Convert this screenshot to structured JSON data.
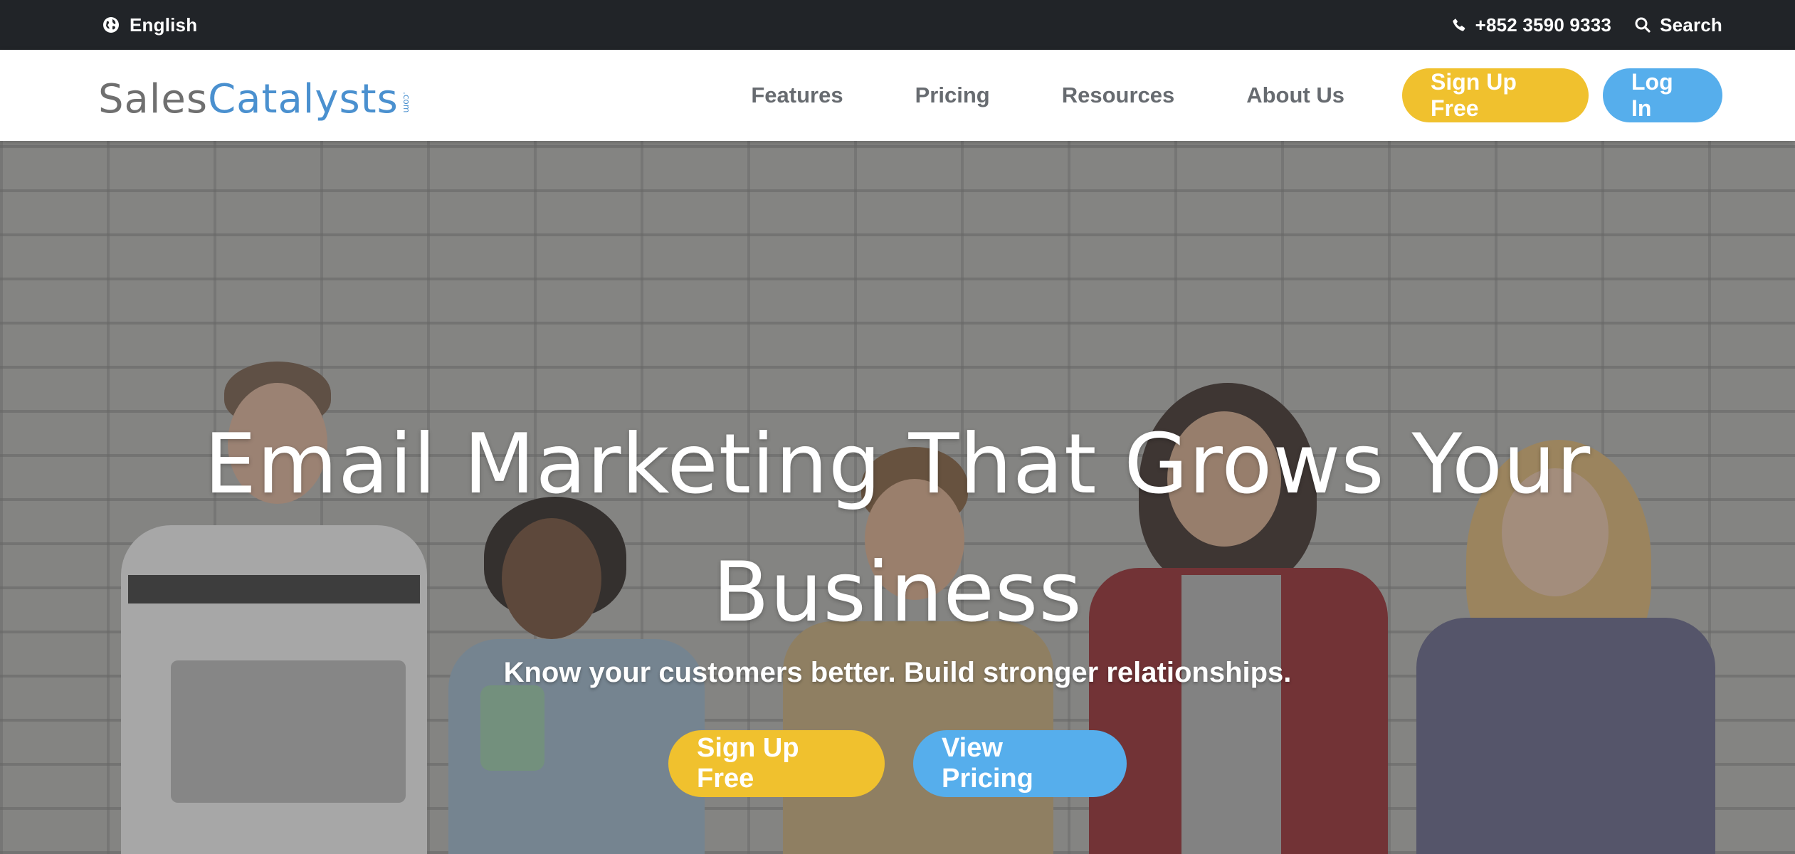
{
  "topbar": {
    "language": "English",
    "phone": "+852 3590 9333",
    "search": "Search",
    "icons": {
      "language": "globe-icon",
      "phone": "phone-icon",
      "search": "search-icon"
    }
  },
  "header": {
    "logo": {
      "part1": "Sales",
      "part2": "Catalysts",
      "suffix": ".com"
    },
    "nav": [
      "Features",
      "Pricing",
      "Resources",
      "About Us"
    ],
    "signup_label": "Sign Up Free",
    "login_label": "Log In"
  },
  "hero": {
    "headline_line1": "Email Marketing That Grows Your",
    "headline_line2": "Business",
    "subheadline": "Know your customers better. Build stronger relationships.",
    "cta_primary": "Sign Up Free",
    "cta_secondary": "View Pricing"
  },
  "colors": {
    "topbar_bg": "#212428",
    "accent_yellow": "#f0c12e",
    "accent_blue": "#56aeec",
    "nav_text": "#676b70",
    "logo_gray": "#6f6f6f",
    "logo_blue": "#4a90cf"
  }
}
